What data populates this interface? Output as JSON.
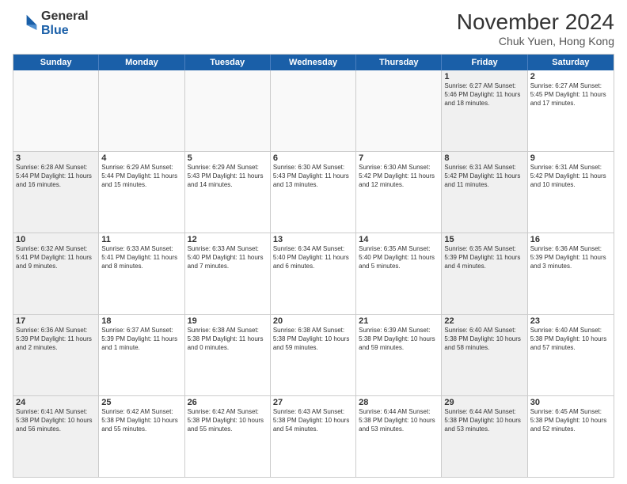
{
  "logo": {
    "line1": "General",
    "line2": "Blue"
  },
  "title": "November 2024",
  "subtitle": "Chuk Yuen, Hong Kong",
  "headers": [
    "Sunday",
    "Monday",
    "Tuesday",
    "Wednesday",
    "Thursday",
    "Friday",
    "Saturday"
  ],
  "weeks": [
    [
      {
        "day": "",
        "text": "",
        "empty": true
      },
      {
        "day": "",
        "text": "",
        "empty": true
      },
      {
        "day": "",
        "text": "",
        "empty": true
      },
      {
        "day": "",
        "text": "",
        "empty": true
      },
      {
        "day": "",
        "text": "",
        "empty": true
      },
      {
        "day": "1",
        "text": "Sunrise: 6:27 AM\nSunset: 5:46 PM\nDaylight: 11 hours and 18 minutes.",
        "shaded": true
      },
      {
        "day": "2",
        "text": "Sunrise: 6:27 AM\nSunset: 5:45 PM\nDaylight: 11 hours and 17 minutes.",
        "shaded": false
      }
    ],
    [
      {
        "day": "3",
        "text": "Sunrise: 6:28 AM\nSunset: 5:44 PM\nDaylight: 11 hours and 16 minutes.",
        "shaded": true
      },
      {
        "day": "4",
        "text": "Sunrise: 6:29 AM\nSunset: 5:44 PM\nDaylight: 11 hours and 15 minutes.",
        "shaded": false
      },
      {
        "day": "5",
        "text": "Sunrise: 6:29 AM\nSunset: 5:43 PM\nDaylight: 11 hours and 14 minutes.",
        "shaded": false
      },
      {
        "day": "6",
        "text": "Sunrise: 6:30 AM\nSunset: 5:43 PM\nDaylight: 11 hours and 13 minutes.",
        "shaded": false
      },
      {
        "day": "7",
        "text": "Sunrise: 6:30 AM\nSunset: 5:42 PM\nDaylight: 11 hours and 12 minutes.",
        "shaded": false
      },
      {
        "day": "8",
        "text": "Sunrise: 6:31 AM\nSunset: 5:42 PM\nDaylight: 11 hours and 11 minutes.",
        "shaded": true
      },
      {
        "day": "9",
        "text": "Sunrise: 6:31 AM\nSunset: 5:42 PM\nDaylight: 11 hours and 10 minutes.",
        "shaded": false
      }
    ],
    [
      {
        "day": "10",
        "text": "Sunrise: 6:32 AM\nSunset: 5:41 PM\nDaylight: 11 hours and 9 minutes.",
        "shaded": true
      },
      {
        "day": "11",
        "text": "Sunrise: 6:33 AM\nSunset: 5:41 PM\nDaylight: 11 hours and 8 minutes.",
        "shaded": false
      },
      {
        "day": "12",
        "text": "Sunrise: 6:33 AM\nSunset: 5:40 PM\nDaylight: 11 hours and 7 minutes.",
        "shaded": false
      },
      {
        "day": "13",
        "text": "Sunrise: 6:34 AM\nSunset: 5:40 PM\nDaylight: 11 hours and 6 minutes.",
        "shaded": false
      },
      {
        "day": "14",
        "text": "Sunrise: 6:35 AM\nSunset: 5:40 PM\nDaylight: 11 hours and 5 minutes.",
        "shaded": false
      },
      {
        "day": "15",
        "text": "Sunrise: 6:35 AM\nSunset: 5:39 PM\nDaylight: 11 hours and 4 minutes.",
        "shaded": true
      },
      {
        "day": "16",
        "text": "Sunrise: 6:36 AM\nSunset: 5:39 PM\nDaylight: 11 hours and 3 minutes.",
        "shaded": false
      }
    ],
    [
      {
        "day": "17",
        "text": "Sunrise: 6:36 AM\nSunset: 5:39 PM\nDaylight: 11 hours and 2 minutes.",
        "shaded": true
      },
      {
        "day": "18",
        "text": "Sunrise: 6:37 AM\nSunset: 5:39 PM\nDaylight: 11 hours and 1 minute.",
        "shaded": false
      },
      {
        "day": "19",
        "text": "Sunrise: 6:38 AM\nSunset: 5:38 PM\nDaylight: 11 hours and 0 minutes.",
        "shaded": false
      },
      {
        "day": "20",
        "text": "Sunrise: 6:38 AM\nSunset: 5:38 PM\nDaylight: 10 hours and 59 minutes.",
        "shaded": false
      },
      {
        "day": "21",
        "text": "Sunrise: 6:39 AM\nSunset: 5:38 PM\nDaylight: 10 hours and 59 minutes.",
        "shaded": false
      },
      {
        "day": "22",
        "text": "Sunrise: 6:40 AM\nSunset: 5:38 PM\nDaylight: 10 hours and 58 minutes.",
        "shaded": true
      },
      {
        "day": "23",
        "text": "Sunrise: 6:40 AM\nSunset: 5:38 PM\nDaylight: 10 hours and 57 minutes.",
        "shaded": false
      }
    ],
    [
      {
        "day": "24",
        "text": "Sunrise: 6:41 AM\nSunset: 5:38 PM\nDaylight: 10 hours and 56 minutes.",
        "shaded": true
      },
      {
        "day": "25",
        "text": "Sunrise: 6:42 AM\nSunset: 5:38 PM\nDaylight: 10 hours and 55 minutes.",
        "shaded": false
      },
      {
        "day": "26",
        "text": "Sunrise: 6:42 AM\nSunset: 5:38 PM\nDaylight: 10 hours and 55 minutes.",
        "shaded": false
      },
      {
        "day": "27",
        "text": "Sunrise: 6:43 AM\nSunset: 5:38 PM\nDaylight: 10 hours and 54 minutes.",
        "shaded": false
      },
      {
        "day": "28",
        "text": "Sunrise: 6:44 AM\nSunset: 5:38 PM\nDaylight: 10 hours and 53 minutes.",
        "shaded": false
      },
      {
        "day": "29",
        "text": "Sunrise: 6:44 AM\nSunset: 5:38 PM\nDaylight: 10 hours and 53 minutes.",
        "shaded": true
      },
      {
        "day": "30",
        "text": "Sunrise: 6:45 AM\nSunset: 5:38 PM\nDaylight: 10 hours and 52 minutes.",
        "shaded": false
      }
    ]
  ]
}
